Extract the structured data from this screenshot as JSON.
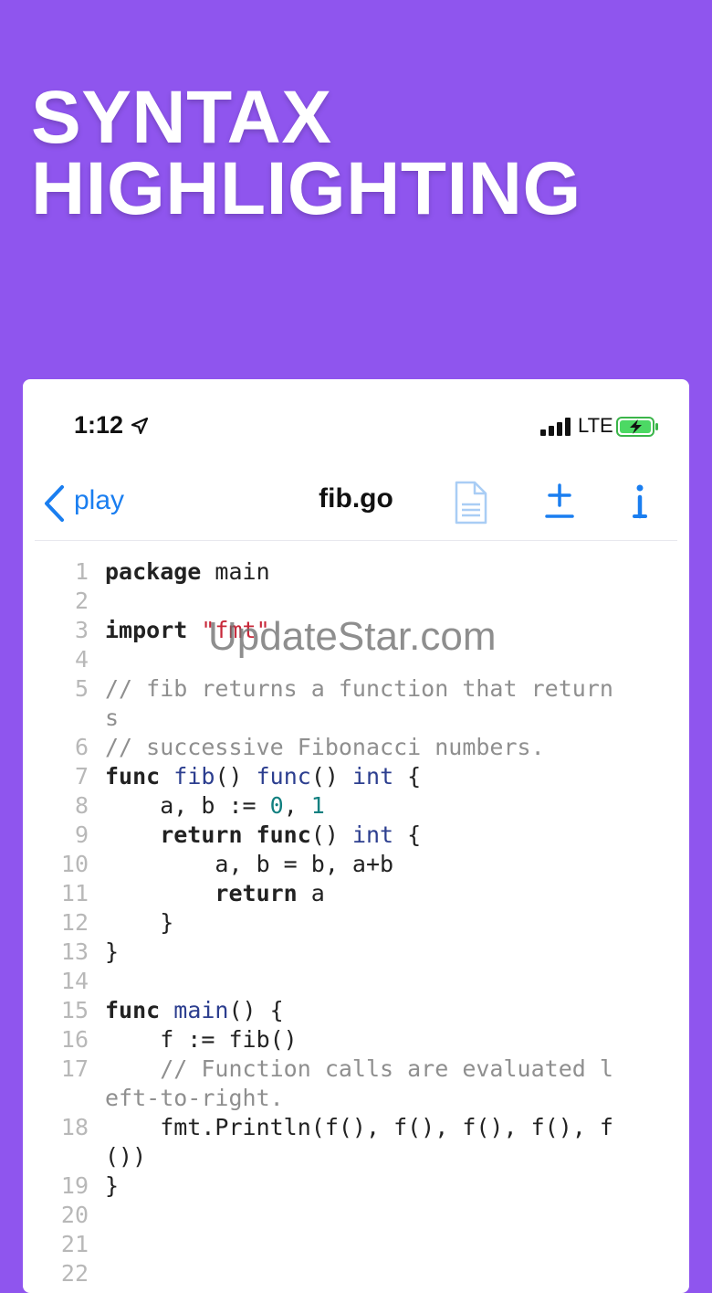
{
  "hero": {
    "line1": "SYNTAX",
    "line2": "HIGHLIGHTING"
  },
  "status_bar": {
    "time": "1:12",
    "network": "LTE"
  },
  "navbar": {
    "back_label": "play",
    "title": "fib.go"
  },
  "icons": {
    "back": "chevron-left-icon",
    "location": "location-arrow-icon",
    "signal": "cellular-signal-icon",
    "battery": "battery-charging-icon",
    "document": "document-icon",
    "diff": "plus-minus-icon",
    "info": "info-icon"
  },
  "colors": {
    "background": "#8f55ee",
    "accent": "#1a7ef0",
    "keyword_blue": "#2c3e8f",
    "number": "#128080",
    "string": "#c8283a",
    "comment": "#8f8f8f"
  },
  "code": {
    "line_numbers": [
      "1",
      "2",
      "3",
      "4",
      "5",
      "",
      "6",
      "7",
      "8",
      "9",
      "10",
      "11",
      "12",
      "13",
      "14",
      "15",
      "16",
      "17",
      "",
      "18",
      "",
      "19",
      "20",
      "21",
      "22"
    ],
    "l1_kw": "package",
    "l1_rest": " main",
    "l3_kw": "import",
    "l3_str": "\"fmt\"",
    "l5_a": "// fib returns a function that return",
    "l5_b": "s",
    "l6": "// successive Fibonacci numbers.",
    "l7_kw1": "func",
    "l7_name": "fib",
    "l7_p1": "() ",
    "l7_kw2": "func",
    "l7_p2": "() ",
    "l7_kw3": "int",
    "l7_brace": " {",
    "l8_a": "    a, b := ",
    "l8_n1": "0",
    "l8_sep": ", ",
    "l8_n2": "1",
    "l9_kw": "    return func",
    "l9_p": "() ",
    "l9_int": "int",
    "l9_brace": " {",
    "l10": "        a, b = b, a+b",
    "l11_kw": "        return",
    "l11_rest": " a",
    "l12": "    }",
    "l13": "}",
    "l15_kw": "func",
    "l15_name": "main",
    "l15_rest": "() {",
    "l16": "    f := fib()",
    "l17_a": "    // Function calls are evaluated l",
    "l17_b": "eft-to-right.",
    "l18_a": "    fmt.Println(f(), f(), f(), f(), f",
    "l18_b": "())",
    "l19": "}"
  },
  "watermark": "UpdateStar.com"
}
